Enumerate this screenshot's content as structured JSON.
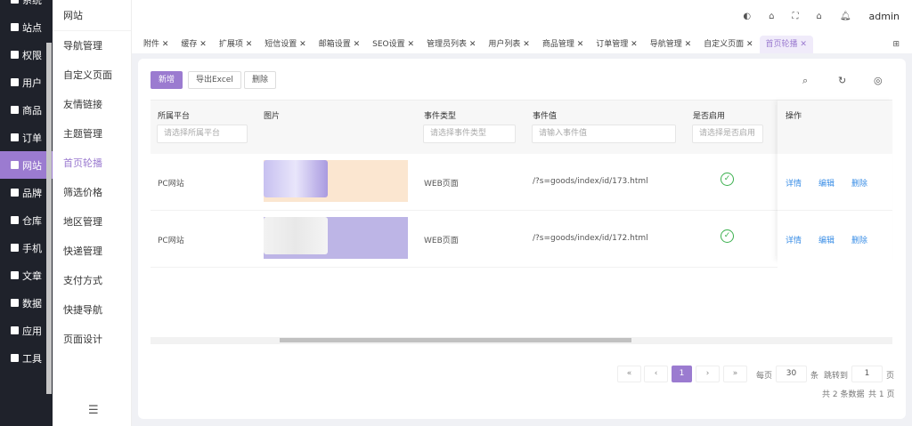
{
  "sidebar": {
    "items": [
      {
        "label": "系统"
      },
      {
        "label": "站点"
      },
      {
        "label": "权限"
      },
      {
        "label": "用户"
      },
      {
        "label": "商品"
      },
      {
        "label": "订单"
      },
      {
        "label": "网站"
      },
      {
        "label": "品牌"
      },
      {
        "label": "仓库"
      },
      {
        "label": "手机"
      },
      {
        "label": "文章"
      },
      {
        "label": "数据"
      },
      {
        "label": "应用"
      },
      {
        "label": "工具"
      }
    ],
    "active": "网站"
  },
  "submenu": {
    "title": "网站",
    "items": [
      "导航管理",
      "自定义页面",
      "友情链接",
      "主题管理",
      "首页轮播",
      "筛选价格",
      "地区管理",
      "快递管理",
      "支付方式",
      "快捷导航",
      "页面设计"
    ],
    "active": "首页轮播"
  },
  "header": {
    "user": "admin"
  },
  "tabs": [
    "附件",
    "缓存",
    "扩展项",
    "短信设置",
    "邮箱设置",
    "SEO设置",
    "管理员列表",
    "用户列表",
    "商品管理",
    "订单管理",
    "导航管理",
    "自定义页面",
    "首页轮播"
  ],
  "toolbar": {
    "add": "新增",
    "export": "导出Excel",
    "delete": "删除"
  },
  "table": {
    "columns": [
      "所属平台",
      "图片",
      "事件类型",
      "事件值",
      "是否启用",
      "操作"
    ],
    "filters": {
      "platform": "请选择所属平台",
      "event_type": "请选择事件类型",
      "event_value": "请输入事件值",
      "enabled": "请选择是否启用"
    },
    "rows": [
      {
        "platform": "PC网站",
        "event_type": "WEB页面",
        "event_value": "/?s=goods/index/id/173.html",
        "enabled": true,
        "bg": "#fbe6d0"
      },
      {
        "platform": "PC网站",
        "event_type": "WEB页面",
        "event_value": "/?s=goods/index/id/172.html",
        "enabled": true,
        "bg": "#bdb5e6"
      }
    ],
    "actions": {
      "detail": "详情",
      "edit": "编辑",
      "delete": "删除"
    }
  },
  "pagination": {
    "first": "«",
    "prev": "‹",
    "current": "1",
    "next": "›",
    "last": "»",
    "per_page_label": "每页",
    "per_page": "30",
    "unit": "条",
    "jump_label": "跳转到",
    "jump": "1",
    "page_unit": "页",
    "summary": "共 2 条数据",
    "pages": "共 1 页"
  },
  "colors": {
    "accent": "#9b7bd0",
    "sidebar": "#1f222b"
  }
}
